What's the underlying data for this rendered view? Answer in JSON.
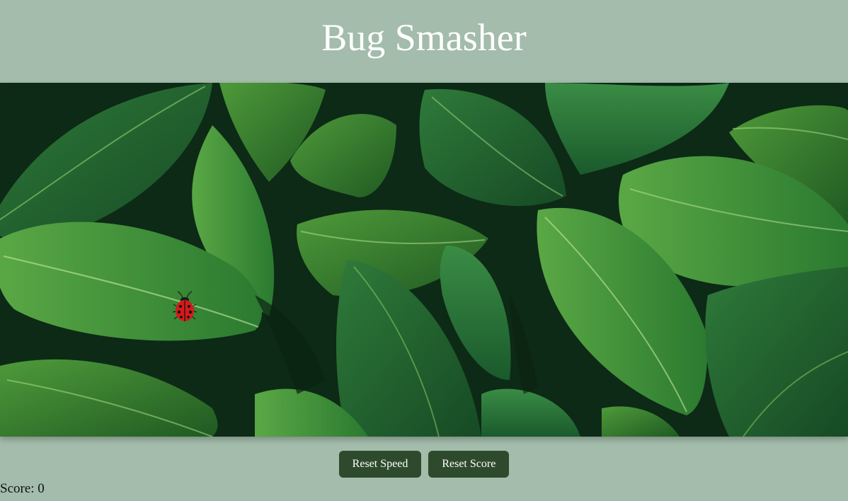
{
  "title": "Bug Smasher",
  "game": {
    "background_icon": "tropical-leaves-background",
    "bug_icon": "ladybug-icon"
  },
  "controls": {
    "reset_speed_label": "Reset Speed",
    "reset_score_label": "Reset Score"
  },
  "score": {
    "label": "Score:",
    "value": "0"
  },
  "colors": {
    "page_background": "#a3bcab",
    "button_background": "#2d4a2d",
    "button_text": "#ffffff",
    "title_text": "#ffffff",
    "bug_red": "#d51a1a"
  }
}
